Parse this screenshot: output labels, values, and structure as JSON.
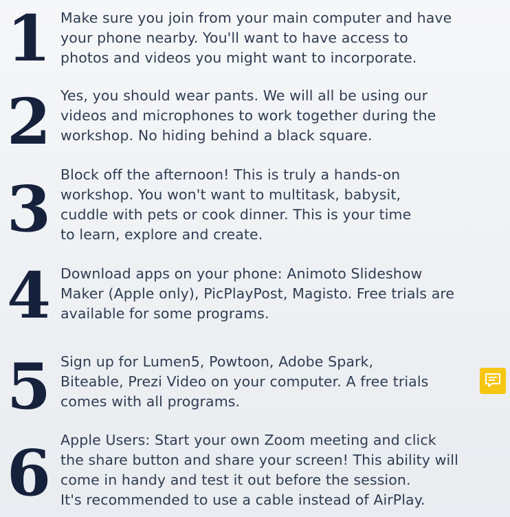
{
  "items": [
    {
      "number": "1",
      "lines": [
        "Make sure you join from your main computer and have",
        "your phone nearby. You'll want to have access to",
        "photos and videos you might want to incorporate."
      ]
    },
    {
      "number": "2",
      "lines": [
        "Yes, you should wear pants. We will all be using our",
        "videos and microphones to work together during the",
        "workshop. No hiding behind a black square."
      ]
    },
    {
      "number": "3",
      "lines": [
        "Block off the afternoon! This is truly a hands-on",
        "workshop. You won't want to multitask, babysit,",
        "cuddle with pets or cook dinner. This is your time",
        "to learn, explore and create."
      ]
    },
    {
      "number": "4",
      "lines": [
        "Download apps on your phone: Animoto Slideshow",
        "Maker (Apple only), PicPlayPost, Magisto. Free trials are",
        "available for some programs."
      ]
    },
    {
      "number": "5",
      "lines": [
        "Sign up for Lumen5, Powtoon, Adobe Spark,",
        "Biteable, Prezi Video on your computer. A free trials",
        "comes with all programs."
      ]
    },
    {
      "number": "6",
      "lines": [
        "Apple Users: Start your own Zoom meeting and click",
        "the share button and share your screen! This ability will",
        "come in handy and test it out before the session.",
        "It's recommended to use a cable instead of AirPlay."
      ]
    }
  ],
  "note_button": {
    "icon": "comment-icon",
    "color": "#f6c612"
  }
}
